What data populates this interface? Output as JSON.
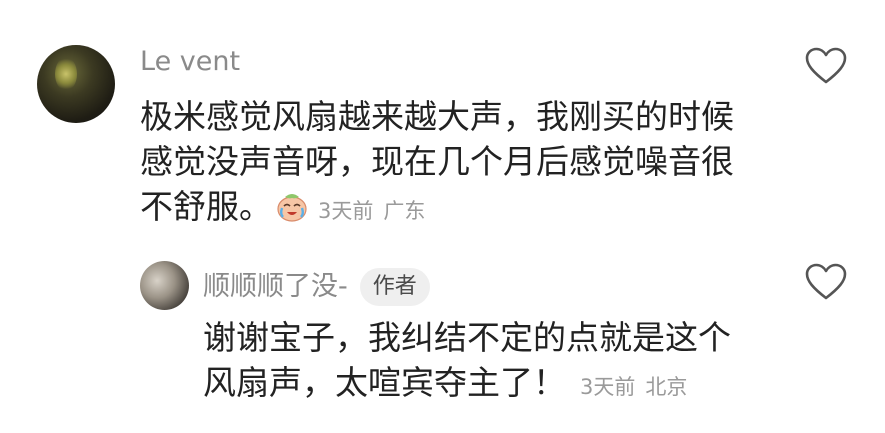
{
  "comment": {
    "username": "Le vent",
    "lines": [
      "极米感觉风扇越来越大声，我刚买的时候",
      "感觉没声音呀，现在几个月后感觉噪音很",
      "不舒服。"
    ],
    "emoji_icon": "crying-laughing-emoji-icon",
    "time": "3天前",
    "location": "广东"
  },
  "reply": {
    "username": "顺顺顺了没-",
    "badge": "作者",
    "lines": [
      "谢谢宝子，我纠结不定的点就是这个",
      "风扇声，太喧宾夺主了！"
    ],
    "time": "3天前",
    "location": "北京"
  },
  "icons": {
    "like": "heart-outline-icon"
  },
  "colors": {
    "username": "#8a8a8a",
    "text": "#222222",
    "meta": "#9a9a9a",
    "badge_bg": "#efefef",
    "icon_stroke": "#555555"
  }
}
